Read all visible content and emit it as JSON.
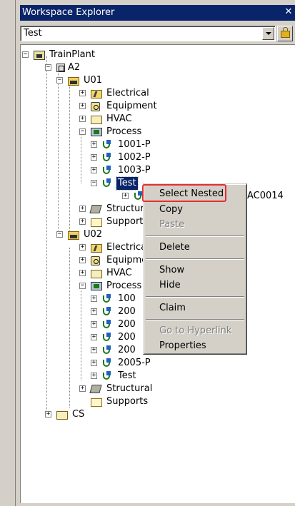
{
  "panel": {
    "title": "Workspace Explorer",
    "close_glyph": "✕"
  },
  "filter": {
    "value": "Test"
  },
  "tree": {
    "nodes": [
      {
        "label": "TrainPlant",
        "icon": "plant-icon"
      },
      {
        "label": "A2",
        "icon": "area-icon"
      },
      {
        "label": "U01",
        "icon": "unit-icon"
      },
      {
        "label": "Electrical",
        "icon": "electrical-icon"
      },
      {
        "label": "Equipment",
        "icon": "equipment-icon"
      },
      {
        "label": "HVAC",
        "icon": "hvac-icon"
      },
      {
        "label": "Process",
        "icon": "process-icon"
      },
      {
        "label": "1001-P",
        "icon": "pipeline-icon"
      },
      {
        "label": "1002-P",
        "icon": "pipeline-icon"
      },
      {
        "label": "1003-P",
        "icon": "pipeline-icon"
      },
      {
        "label": "Test",
        "icon": "pipeline-icon",
        "selected": true
      },
      {
        "label": "AC0014",
        "icon": "pipe-run-icon"
      },
      {
        "label": "Structural",
        "icon": "structural-icon"
      },
      {
        "label": "Supports",
        "icon": "supports-icon"
      },
      {
        "label": "U02",
        "icon": "unit-icon"
      },
      {
        "label": "Electrical",
        "icon": "electrical-icon"
      },
      {
        "label": "Equipment",
        "icon": "equipment-icon"
      },
      {
        "label": "HVAC",
        "icon": "hvac-icon"
      },
      {
        "label": "Process",
        "icon": "process-icon"
      },
      {
        "label": "100",
        "icon": "pipeline-icon"
      },
      {
        "label": "200",
        "icon": "pipeline-icon"
      },
      {
        "label": "200",
        "icon": "pipeline-icon"
      },
      {
        "label": "200",
        "icon": "pipeline-icon"
      },
      {
        "label": "200",
        "icon": "pipeline-icon"
      },
      {
        "label": "2005-P",
        "icon": "pipeline-icon"
      },
      {
        "label": "Test",
        "icon": "pipeline-icon"
      },
      {
        "label": "Structural",
        "icon": "structural-icon"
      },
      {
        "label": "Supports",
        "icon": "supports-icon"
      },
      {
        "label": "CS",
        "icon": "cs-icon"
      }
    ]
  },
  "context_menu": {
    "items": [
      {
        "label": "Select Nested",
        "enabled": true,
        "highlighted": true
      },
      {
        "label": "Copy",
        "enabled": true
      },
      {
        "label": "Paste",
        "enabled": false
      },
      {
        "label": "Delete",
        "enabled": true
      },
      {
        "label": "Show",
        "enabled": true
      },
      {
        "label": "Hide",
        "enabled": true
      },
      {
        "label": "Claim",
        "enabled": true
      },
      {
        "label": "Go to Hyperlink",
        "enabled": false
      },
      {
        "label": "Properties",
        "enabled": true
      }
    ]
  },
  "colors": {
    "title_bg": "#0a246a",
    "selection_bg": "#0a246a",
    "annotation": "#e03030"
  }
}
